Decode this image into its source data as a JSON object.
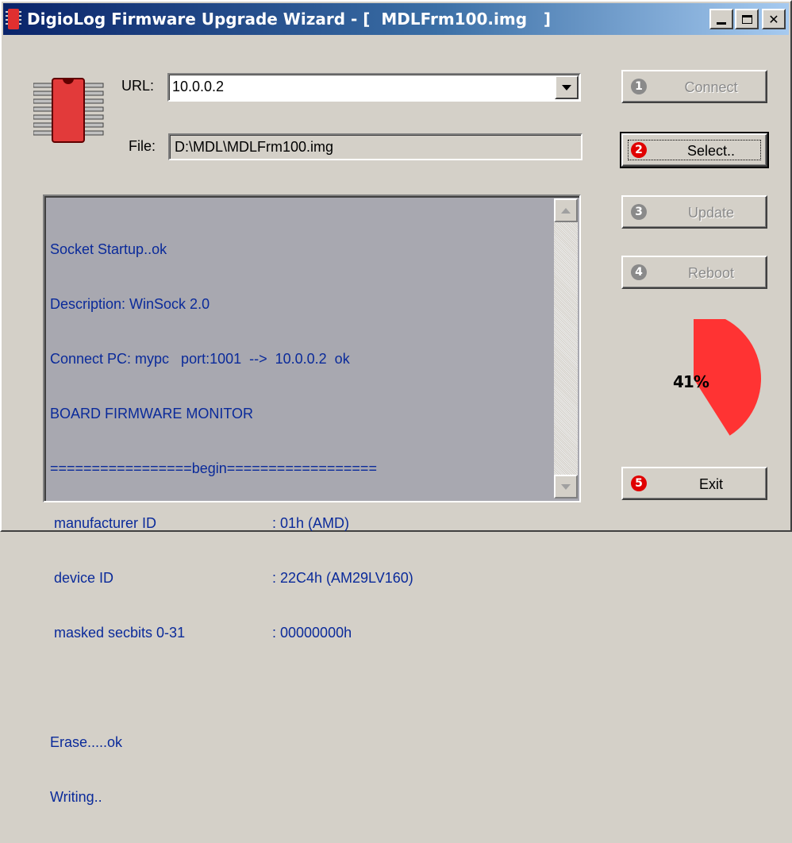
{
  "window": {
    "title": "DigioLog Firmware Upgrade Wizard - [  MDLFrm100.img   ]",
    "caption_buttons": [
      "minimize",
      "maximize",
      "close"
    ]
  },
  "form": {
    "url_label": "URL:",
    "url_value": "10.0.0.2",
    "file_label": "File:",
    "file_value": "D:\\MDL\\MDLFrm100.img"
  },
  "log": {
    "lines": [
      "Socket Startup..ok",
      "Description: WinSock 2.0",
      "Connect PC: mypc   port:1001  -->  10.0.0.2  ok",
      "BOARD FIRMWARE MONITOR",
      "=================begin=================="
    ],
    "fields": [
      {
        "key": " manufacturer ID",
        "value": ": 01h (AMD)"
      },
      {
        "key": " device ID",
        "value": ": 22C4h (AM29LV160)"
      },
      {
        "key": " masked secbits 0-31",
        "value": ": 00000000h"
      }
    ],
    "tail": [
      "",
      "Erase.....ok",
      "Writing.."
    ]
  },
  "buttons": {
    "connect": {
      "number": "1",
      "label": "Connect",
      "enabled": false
    },
    "select": {
      "number": "2",
      "label": "Select..",
      "enabled": true
    },
    "update": {
      "number": "3",
      "label": "Update",
      "enabled": false
    },
    "reboot": {
      "number": "4",
      "label": "Reboot",
      "enabled": false
    },
    "exit": {
      "number": "5",
      "label": "Exit",
      "enabled": true
    }
  },
  "progress": {
    "percent": 41,
    "label": "41%",
    "color": "#ff3333"
  },
  "colors": {
    "title_gradient_start": "#0a246a",
    "title_gradient_end": "#a6caf0",
    "log_text": "#0a2a9a",
    "log_background": "#a8a8b0",
    "accent_red": "#e00000"
  },
  "icons": {
    "app": "chip-icon",
    "main": "chip-icon"
  }
}
